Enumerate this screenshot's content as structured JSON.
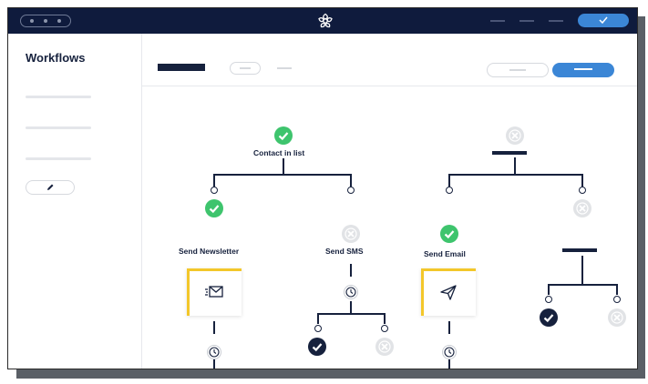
{
  "titlebar": {
    "logo_icon": "flower-logo-icon",
    "confirm_icon": "check-icon"
  },
  "sidebar": {
    "title": "Workflows",
    "edit_icon": "pencil-icon"
  },
  "workflow": {
    "nodes": [
      {
        "id": "contact-in-list",
        "label": "Contact in list",
        "status": "active"
      },
      {
        "id": "send-newsletter",
        "label": "Send Newsletter",
        "status": "active",
        "card_icon": "email-icon"
      },
      {
        "id": "send-sms",
        "label": "Send SMS",
        "status": "inactive"
      },
      {
        "id": "send-email",
        "label": "Send Email",
        "status": "active",
        "card_icon": "send-icon"
      }
    ]
  },
  "colors": {
    "navy": "#16213d",
    "accent_blue": "#3b86d6",
    "success_green": "#3ec46d",
    "inactive_gray": "#e1e3e6",
    "card_accent_yellow": "#f3c72a"
  }
}
